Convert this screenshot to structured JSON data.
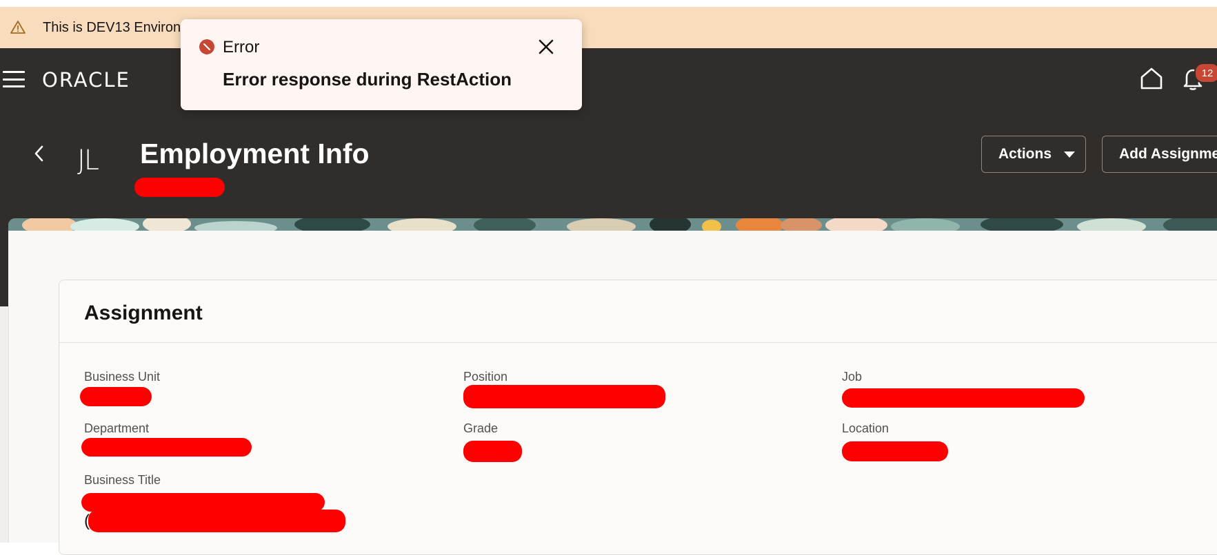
{
  "env_banner": {
    "text": "This is DEV13 Environ",
    "icon": "warning-icon",
    "color": "#f9dcbd"
  },
  "header": {
    "logo": "ORACLE",
    "notifications_count": "12",
    "icons": [
      "menu-icon",
      "home-icon",
      "bell-icon"
    ],
    "background": "#312d2a"
  },
  "page": {
    "avatar_initials": "JL",
    "title": "Employment Info",
    "actions_label": "Actions",
    "add_assignment_label": "Add Assignment"
  },
  "toast": {
    "title": "Error",
    "message": "Error response during RestAction",
    "severity_color": "#c74634"
  },
  "assignment": {
    "title": "Assignment",
    "fields": {
      "business_unit": {
        "label": "Business Unit"
      },
      "position": {
        "label": "Position"
      },
      "job": {
        "label": "Job"
      },
      "department": {
        "label": "Department"
      },
      "grade": {
        "label": "Grade"
      },
      "location": {
        "label": "Location"
      },
      "business_title": {
        "label": "Business Title",
        "value_prefix": "("
      }
    }
  }
}
